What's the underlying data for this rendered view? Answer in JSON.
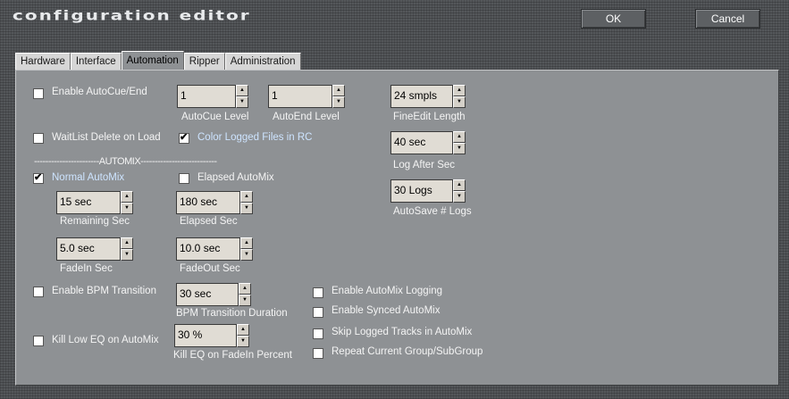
{
  "window": {
    "title": "configuration editor",
    "ok_label": "OK",
    "cancel_label": "Cancel"
  },
  "tabs": [
    {
      "label": "Hardware"
    },
    {
      "label": "Interface"
    },
    {
      "label": "Automation",
      "active": true
    },
    {
      "label": "Ripper"
    },
    {
      "label": "Administration"
    }
  ],
  "automation": {
    "enable_autocue_end": {
      "label": "Enable AutoCue/End",
      "checked": false
    },
    "autocue_level": {
      "value": "1",
      "label": "AutoCue Level"
    },
    "autoend_level": {
      "value": "1",
      "label": "AutoEnd Level"
    },
    "fineedit_length": {
      "value": "24 smpls",
      "label": "FineEdit Length"
    },
    "waitlist_delete": {
      "label": "WaitList Delete on Load",
      "checked": false
    },
    "color_logged": {
      "label": "Color Logged Files in RC",
      "checked": true
    },
    "log_after_sec": {
      "value": "40 sec",
      "label": "Log After Sec"
    },
    "automix_separator": "-----------------------AUTOMIX---------------------------",
    "normal_automix": {
      "label": "Normal AutoMix",
      "checked": true
    },
    "elapsed_automix": {
      "label": "Elapsed AutoMix",
      "checked": false
    },
    "autosave_logs": {
      "value": "30 Logs",
      "label": "AutoSave # Logs"
    },
    "remaining_sec": {
      "value": "15 sec",
      "label": "Remaining Sec"
    },
    "elapsed_sec": {
      "value": "180 sec",
      "label": "Elapsed Sec"
    },
    "fadein_sec": {
      "value": "5.0 sec",
      "label": "FadeIn Sec"
    },
    "fadeout_sec": {
      "value": "10.0 sec",
      "label": "FadeOut Sec"
    },
    "enable_bpm": {
      "label": "Enable BPM Transition",
      "checked": false
    },
    "bpm_duration": {
      "value": "30 sec",
      "label": "BPM Transition Duration"
    },
    "enable_automix_logging": {
      "label": "Enable AutoMix Logging",
      "checked": false
    },
    "enable_synced_automix": {
      "label": "Enable Synced AutoMix",
      "checked": false
    },
    "kill_low_eq": {
      "label": "Kill Low EQ on AutoMix",
      "checked": false
    },
    "kill_eq_percent": {
      "value": "30 %",
      "label": "Kill EQ on FadeIn Percent"
    },
    "skip_logged": {
      "label": "Skip Logged Tracks in AutoMix",
      "checked": false
    },
    "repeat_group": {
      "label": "Repeat Current Group/SubGroup",
      "checked": false
    }
  }
}
